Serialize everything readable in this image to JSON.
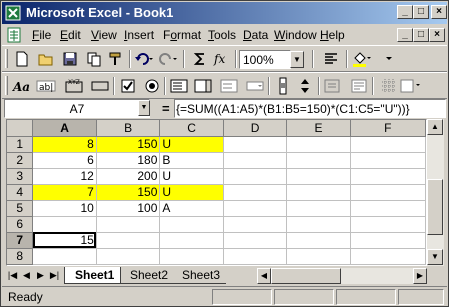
{
  "window": {
    "title": "Microsoft Excel - Book1",
    "controls": {
      "minimize": "_",
      "maximize": "□",
      "close": "×"
    }
  },
  "menu": {
    "items": [
      {
        "ul": "F",
        "rest": "ile"
      },
      {
        "ul": "E",
        "rest": "dit"
      },
      {
        "ul": "V",
        "rest": "iew"
      },
      {
        "ul": "I",
        "rest": "nsert"
      },
      {
        "pre": "F",
        "ul": "o",
        "rest": "rmat"
      },
      {
        "ul": "T",
        "rest": "ools"
      },
      {
        "ul": "D",
        "rest": "ata"
      },
      {
        "ul": "W",
        "rest": "indow"
      },
      {
        "ul": "H",
        "rest": "elp"
      }
    ]
  },
  "toolbar": {
    "zoom": "100%",
    "icons": [
      "new-icon",
      "open-icon",
      "save-icon",
      "copy-icon",
      "format-painter-icon",
      "undo-icon",
      "redo-icon",
      "autosum-icon",
      "function-icon",
      "align-icon",
      "fill-color-icon",
      "toolbar-options-icon",
      "label-icon",
      "edit-box-icon",
      "group-box-icon",
      "button-icon",
      "checkbox-icon",
      "option-button-icon",
      "list-box-icon",
      "combo-box-icon",
      "combo-list-icon",
      "combo-dropdown-icon",
      "scroll-bar-icon",
      "spinner-icon",
      "control-properties-icon",
      "edit-code-icon",
      "toggle-grid-icon",
      "run-dialog-icon"
    ]
  },
  "formula_bar": {
    "name_box": "A7",
    "fx": "=",
    "formula": "{=SUM((A1:A5)*(B1:B5=150)*(C1:C5=\"U\"))}"
  },
  "sheet": {
    "columns": [
      "A",
      "B",
      "C",
      "D",
      "E",
      "F"
    ],
    "rows": [
      {
        "n": "1",
        "a": "8",
        "b": "150",
        "c": "U",
        "hl": true
      },
      {
        "n": "2",
        "a": "6",
        "b": "180",
        "c": "B",
        "hl": false
      },
      {
        "n": "3",
        "a": "12",
        "b": "200",
        "c": "U",
        "hl": false
      },
      {
        "n": "4",
        "a": "7",
        "b": "150",
        "c": "U",
        "hl": true
      },
      {
        "n": "5",
        "a": "10",
        "b": "100",
        "c": "A",
        "hl": false
      },
      {
        "n": "6",
        "a": "",
        "b": "",
        "c": "",
        "hl": false
      },
      {
        "n": "7",
        "a": "15",
        "b": "",
        "c": "",
        "hl": false
      },
      {
        "n": "8",
        "a": "",
        "b": "",
        "c": "",
        "hl": false
      }
    ],
    "highlight_color": "#ffff00",
    "active_cell": "A7"
  },
  "tabs": {
    "nav": [
      "|◀",
      "◀",
      "▶",
      "▶|"
    ],
    "sheets": [
      "Sheet1",
      "Sheet2",
      "Sheet3"
    ],
    "active": "Sheet1"
  },
  "status": {
    "text": "Ready"
  }
}
